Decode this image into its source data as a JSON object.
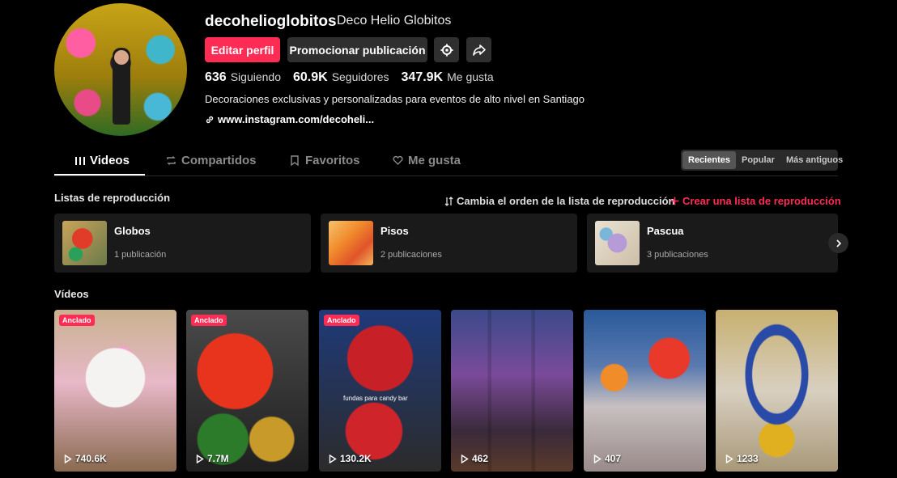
{
  "profile": {
    "username": "decohelioglobitos",
    "display_name": "Deco Helio Globitos",
    "edit_label": "Editar perfil",
    "promote_label": "Promocionar publicación",
    "stats": [
      {
        "value": "636",
        "label": "Siguiendo"
      },
      {
        "value": "60.9K",
        "label": "Seguidores"
      },
      {
        "value": "347.9K",
        "label": "Me gusta"
      }
    ],
    "bio": "Decoraciones exclusivas y personalizadas para eventos de alto nivel en Santiago",
    "link": "www.instagram.com/decoheli..."
  },
  "tabs": [
    {
      "label": "Videos",
      "icon": "grid-icon"
    },
    {
      "label": "Compartidos",
      "icon": "repost-icon"
    },
    {
      "label": "Favoritos",
      "icon": "bookmark-icon"
    },
    {
      "label": "Me gusta",
      "icon": "heart-icon"
    }
  ],
  "sort": {
    "options": [
      "Recientes",
      "Popular",
      "Más antiguos"
    ],
    "selected": "Recientes"
  },
  "playlists_section": {
    "title": "Listas de reproducción",
    "reorder_label": "Cambia el orden de la lista de reproducción",
    "create_label": "Crear una lista de reproducción",
    "items": [
      {
        "name": "Globos",
        "count": "1 publicación"
      },
      {
        "name": "Pisos",
        "count": "2 publicaciones"
      },
      {
        "name": "Pascua",
        "count": "3 publicaciones"
      }
    ]
  },
  "videos_section": {
    "title": "Vídeos",
    "pinned_label": "Anclado",
    "items": [
      {
        "views": "740.6K",
        "pinned": true
      },
      {
        "views": "7.7M",
        "pinned": true
      },
      {
        "views": "130.2K",
        "pinned": true,
        "caption": "fundas para candy bar"
      },
      {
        "views": "462",
        "pinned": false
      },
      {
        "views": "407",
        "pinned": false
      },
      {
        "views": "1233",
        "pinned": false
      }
    ]
  },
  "colors": {
    "accent": "#fe2c55",
    "background": "#000000",
    "surface": "#1a1a1a"
  }
}
